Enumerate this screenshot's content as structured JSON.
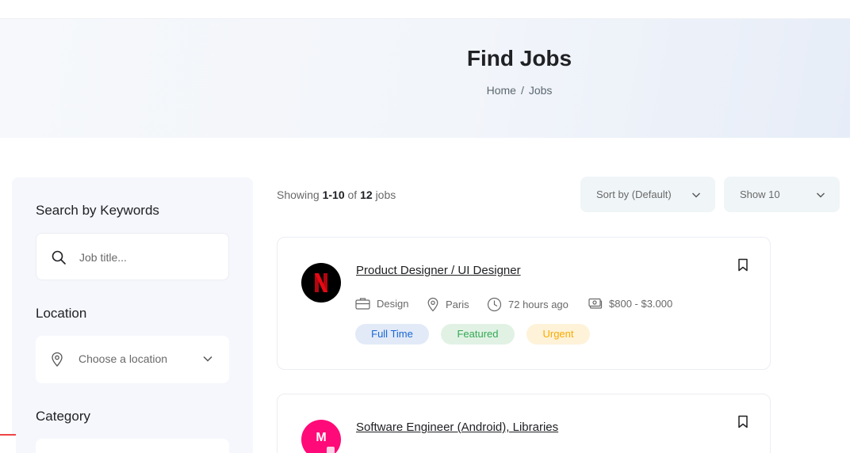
{
  "hero": {
    "title": "Find Jobs",
    "breadcrumb": {
      "home": "Home",
      "separator": "/",
      "current": "Jobs"
    }
  },
  "sidebar": {
    "keywords_heading": "Search by Keywords",
    "keywords_placeholder": "Job title...",
    "location_heading": "Location",
    "location_placeholder": "Choose a location",
    "category_heading": "Category"
  },
  "listing": {
    "showing_prefix": "Showing",
    "showing_range": "1-10",
    "showing_of": "of",
    "showing_total": "12",
    "showing_suffix": "jobs",
    "sort_label": "Sort by (Default)",
    "show_label": "Show 10"
  },
  "jobs": [
    {
      "title": "Product Designer / UI Designer",
      "logo_letter": "N",
      "category": "Design",
      "location": "Paris",
      "posted": "72 hours ago",
      "salary": "$800 - $3.000",
      "tags": [
        "Full Time",
        "Featured",
        "Urgent"
      ]
    },
    {
      "title": "Software Engineer (Android), Libraries",
      "logo_letter": "M"
    }
  ],
  "colors": {
    "accent": "#1967d2",
    "tag_full_time_bg": "#e2eaf8",
    "tag_featured_bg": "#e1f2e5",
    "tag_urgent_bg": "#fef2d9",
    "logo_netflix_bg": "#000000",
    "logo_netflix_fg": "#e50914",
    "logo_m_bg": "#ff0a78"
  },
  "icons": {
    "search": "search-icon",
    "location": "map-pin-icon",
    "chevron": "chevron-down-icon",
    "bookmark": "bookmark-icon",
    "briefcase": "briefcase-icon",
    "clock": "clock-icon",
    "money": "money-icon"
  }
}
